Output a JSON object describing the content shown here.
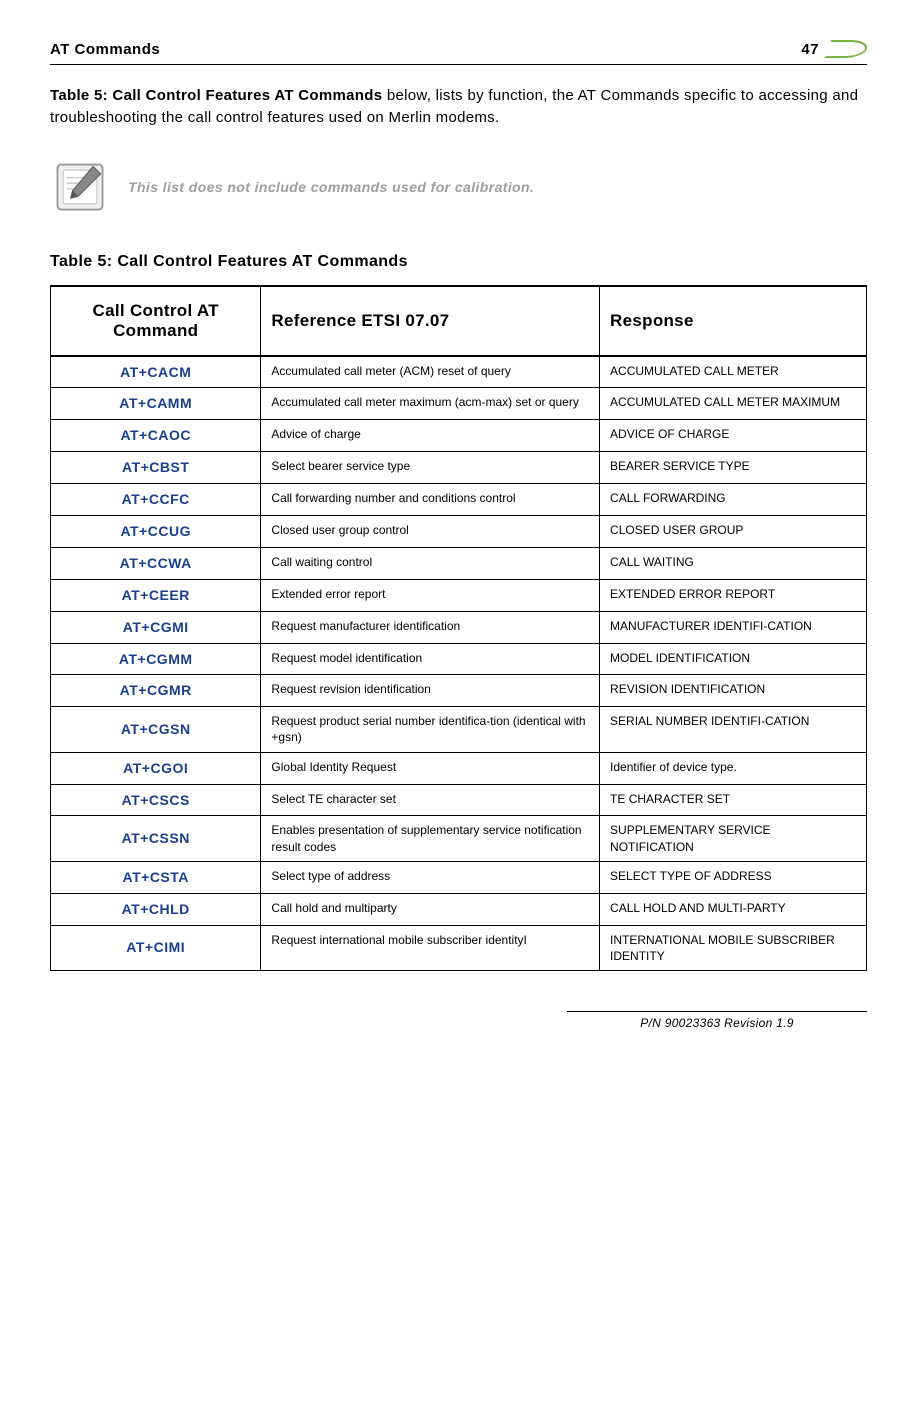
{
  "header": {
    "title": "AT Commands",
    "page": "47"
  },
  "intro": {
    "bold": "Table 5: Call Control Features AT Commands",
    "rest": " below, lists by function, the AT Commands specific to accessing and troubleshooting the call control features used on Merlin modems."
  },
  "note": "This list does not include commands used for calibration.",
  "table_title": "Table 5: Call Control Features AT Commands",
  "columns": {
    "c1": "Call Control AT Command",
    "c2": "Reference ETSI 07.07",
    "c3": "Response"
  },
  "rows": [
    {
      "cmd": "AT+CACM",
      "ref": "Accumulated call meter (ACM) reset of query",
      "resp": "ACCUMULATED CALL METER"
    },
    {
      "cmd": "AT+CAMM",
      "ref": "Accumulated call meter maximum (acm-max) set or query",
      "resp": "ACCUMULATED CALL METER MAXIMUM"
    },
    {
      "cmd": "AT+CAOC",
      "ref": "Advice of charge",
      "resp": "ADVICE OF CHARGE"
    },
    {
      "cmd": "AT+CBST",
      "ref": "Select bearer service type",
      "resp": "BEARER SERVICE TYPE"
    },
    {
      "cmd": "AT+CCFC",
      "ref": "Call forwarding number and conditions control",
      "resp": "CALL FORWARDING"
    },
    {
      "cmd": "AT+CCUG",
      "ref": "Closed user group control",
      "resp": "CLOSED USER GROUP"
    },
    {
      "cmd": "AT+CCWA",
      "ref": "Call waiting control",
      "resp": "CALL WAITING"
    },
    {
      "cmd": "AT+CEER",
      "ref": "Extended error report",
      "resp": "EXTENDED ERROR REPORT"
    },
    {
      "cmd": "AT+CGMI",
      "ref": "Request manufacturer identification",
      "resp": "MANUFACTURER IDENTIFI-CATION"
    },
    {
      "cmd": "AT+CGMM",
      "ref": "Request model identification",
      "resp": "MODEL IDENTIFICATION"
    },
    {
      "cmd": "AT+CGMR",
      "ref": "Request revision identification",
      "resp": "REVISION IDENTIFICATION"
    },
    {
      "cmd": "AT+CGSN",
      "ref": "Request product serial number identifica-tion (identical with +gsn)",
      "resp": "SERIAL NUMBER IDENTIFI-CATION"
    },
    {
      "cmd": "AT+CGOI",
      "ref": "Global Identity Request",
      "resp": "Identifier of device type."
    },
    {
      "cmd": "AT+CSCS",
      "ref": "Select TE character set",
      "resp": "TE CHARACTER SET"
    },
    {
      "cmd": "AT+CSSN",
      "ref": "Enables presentation of supplementary service notification result codes",
      "resp": "SUPPLEMENTARY SERVICE NOTIFICATION"
    },
    {
      "cmd": "AT+CSTA",
      "ref": "Select type of address",
      "resp": "SELECT TYPE OF ADDRESS"
    },
    {
      "cmd": "AT+CHLD",
      "ref": "Call hold and multiparty",
      "resp": "CALL HOLD AND MULTI-PARTY"
    },
    {
      "cmd": "AT+CIMI",
      "ref": "Request international mobile subscriber identityI",
      "resp": "INTERNATIONAL MOBILE SUBSCRIBER IDENTITY"
    }
  ],
  "footer": "P/N 90023363  Revision 1.9"
}
